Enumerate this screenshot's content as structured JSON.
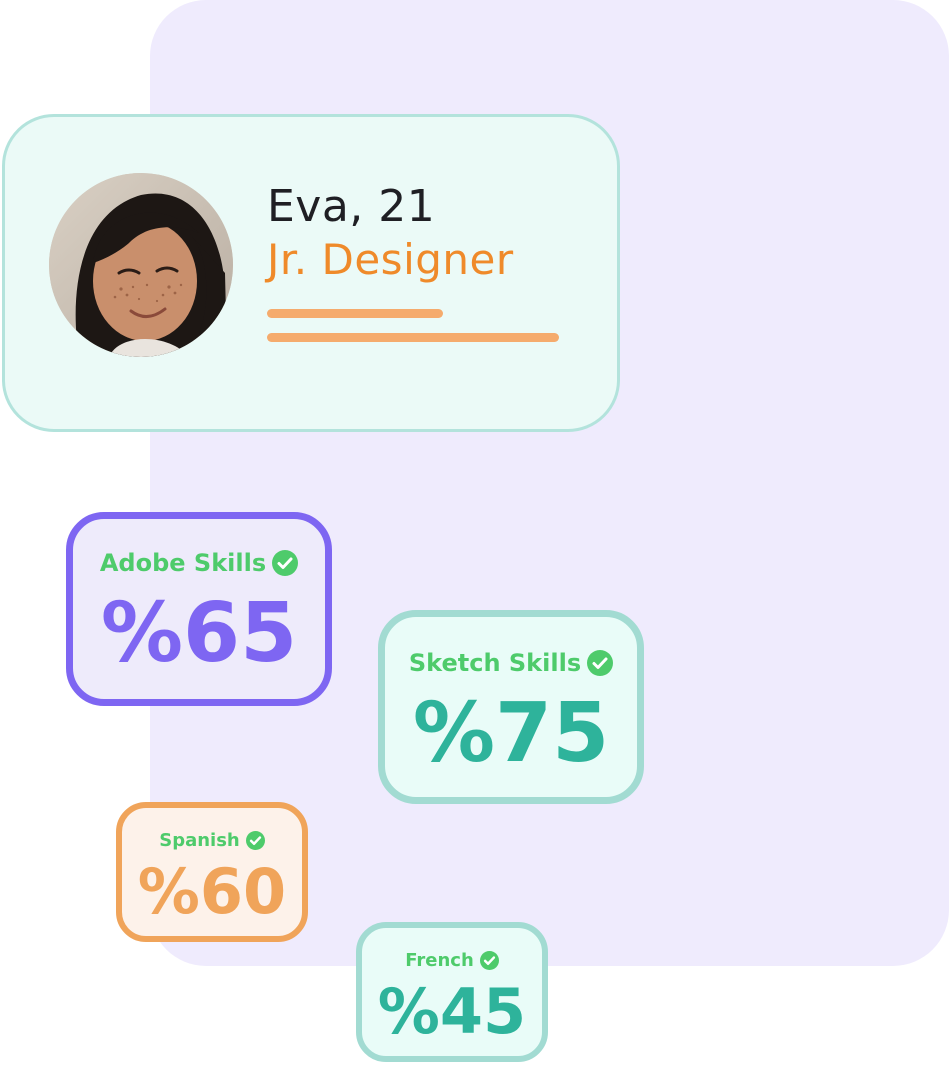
{
  "profile": {
    "name": "Eva, 21",
    "role": "Jr. Designer",
    "avatar_icon": "person-photo"
  },
  "skills": [
    {
      "label": "Adobe Skills",
      "value": "%65",
      "percent": 65,
      "color": "#7e66f2"
    },
    {
      "label": "Sketch Skills",
      "value": "%75",
      "percent": 75,
      "color": "#2eb39b"
    },
    {
      "label": "Spanish",
      "value": "%60",
      "percent": 60,
      "color": "#f0a45a"
    },
    {
      "label": "French",
      "value": "%45",
      "percent": 45,
      "color": "#2eb39b"
    }
  ],
  "colors": {
    "panel": "#efebfd",
    "profile_bg": "#ebfaf7",
    "accent_orange": "#ef8a2a",
    "check_green": "#4ecb6b"
  },
  "icons": {
    "check": "check-circle-icon"
  }
}
